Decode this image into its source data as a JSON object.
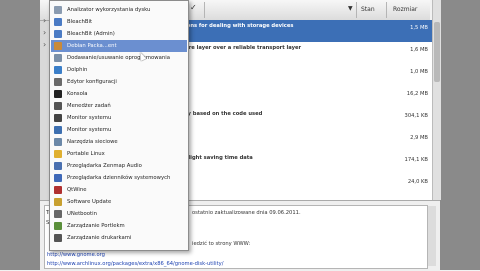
{
  "header": {
    "check_icon": "✓",
    "sort_icon": "▼",
    "status_col": "Stan",
    "size_col": "Rozmiar"
  },
  "packages": [
    {
      "name": "ions for dealing with storage devices",
      "size": "1,5 MB",
      "selected": true
    },
    {
      "name": "ure layer over a reliable transport layer",
      "size": "1,6 MB",
      "selected": false
    },
    {
      "name": "",
      "size": "1,0 MB",
      "selected": false
    },
    {
      "name": "",
      "size": "16,2 MB",
      "selected": false
    },
    {
      "name": "ry based on the code used",
      "size": "304,1 KB",
      "selected": false
    },
    {
      "name": "",
      "size": "2,9 MB",
      "selected": false
    },
    {
      "name": "ylight saving time data",
      "size": "174,1 KB",
      "selected": false
    },
    {
      "name": "",
      "size": "24,0 KB",
      "selected": false
    }
  ],
  "details": {
    "line1": "ostatnio zaktualizowane dnia 09.06.2011.",
    "line2": "iedzić to strony WWW:",
    "link1": "http://www.gnome.org",
    "link2": "http://www.archlinux.org/packages/extra/x86_64/gnome-disk-utility/",
    "prefix_t": "Tr",
    "prefix_s": "Si"
  },
  "menu": {
    "items": [
      {
        "label": "Analizator wykorzystania dysku",
        "icon": "disk-usage-icon",
        "color": "#8a9bb0"
      },
      {
        "label": "BleachBit",
        "icon": "bleachbit-icon",
        "color": "#4b7bc4"
      },
      {
        "label": "BleachBit (Admin)",
        "icon": "bleachbit-admin-icon",
        "color": "#4b7bc4"
      },
      {
        "label": "Debian Packa...ent",
        "icon": "package-icon",
        "color": "#c98a3a",
        "highlighted": true
      },
      {
        "label": "Dodawanie/usuwanie oprogramowania",
        "icon": "software-icon",
        "color": "#7a8fa8"
      },
      {
        "label": "Dolphin",
        "icon": "dolphin-icon",
        "color": "#3a7ec8"
      },
      {
        "label": "Edytor konfiguracji",
        "icon": "config-editor-icon",
        "color": "#6a6a6a"
      },
      {
        "label": "Konsola",
        "icon": "terminal-icon",
        "color": "#222222"
      },
      {
        "label": "Menedżer zadań",
        "icon": "task-manager-icon",
        "color": "#555555"
      },
      {
        "label": "Monitor systemu",
        "icon": "system-monitor-icon",
        "color": "#444444"
      },
      {
        "label": "Monitor systemu",
        "icon": "system-monitor-icon",
        "color": "#3d6fb0"
      },
      {
        "label": "Narzędzia sieciowe",
        "icon": "network-tools-icon",
        "color": "#6b88a8"
      },
      {
        "label": "Portable Linux",
        "icon": "portable-linux-icon",
        "color": "#e0b030"
      },
      {
        "label": "Przeglądarka Zenmap Audio",
        "icon": "zenmap-icon",
        "color": "#4a70b0"
      },
      {
        "label": "Przeglądarka dzienników systemowych",
        "icon": "log-viewer-icon",
        "color": "#3f69b8"
      },
      {
        "label": "QtWine",
        "icon": "wine-icon",
        "color": "#b03030"
      },
      {
        "label": "Software Update",
        "icon": "software-update-icon",
        "color": "#c8a030"
      },
      {
        "label": "UNetbootin",
        "icon": "unetbootin-icon",
        "color": "#666666"
      },
      {
        "label": "Zarządzanie Portlekm",
        "icon": "partition-manager-icon",
        "color": "#5a8f3a"
      },
      {
        "label": "Zarządzanie drukarkami",
        "icon": "printer-icon",
        "color": "#555555"
      }
    ]
  }
}
